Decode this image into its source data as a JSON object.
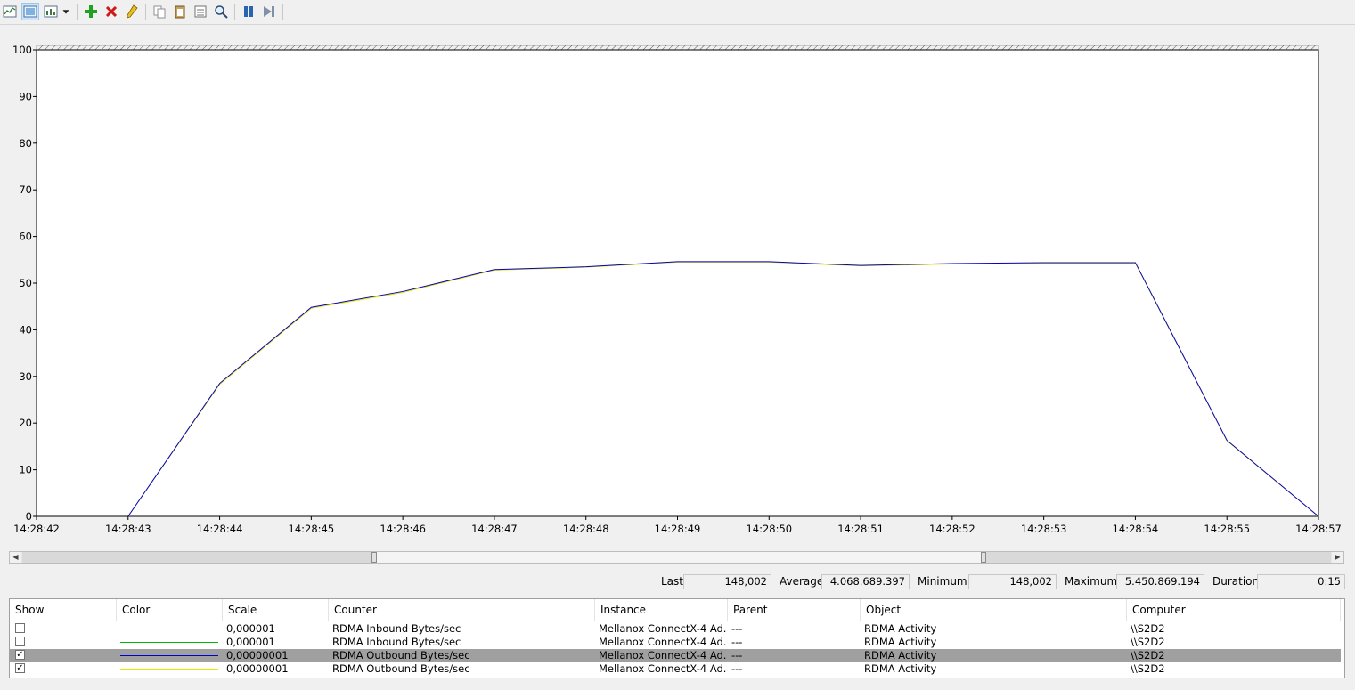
{
  "toolbar": {
    "buttons": [
      {
        "name": "view-current-activity-icon"
      },
      {
        "name": "change-graph-type-icon"
      },
      {
        "name": "graph-type-dropdown-icon"
      },
      {
        "name": "add-counter-icon"
      },
      {
        "name": "delete-counter-icon"
      },
      {
        "name": "highlight-icon"
      },
      {
        "name": "copy-properties-icon"
      },
      {
        "name": "paste-counter-list-icon"
      },
      {
        "name": "properties-icon"
      },
      {
        "name": "zoom-icon"
      },
      {
        "name": "freeze-display-icon"
      },
      {
        "name": "update-data-icon"
      }
    ]
  },
  "chart_data": {
    "type": "line",
    "ylim": [
      0,
      100
    ],
    "y_ticks": [
      "100",
      "90",
      "80",
      "70",
      "60",
      "50",
      "40",
      "30",
      "20",
      "10",
      "0"
    ],
    "x_ticks": [
      "14:28:42",
      "14:28:43",
      "14:28:44",
      "14:28:45",
      "14:28:46",
      "14:28:47",
      "14:28:48",
      "14:28:49",
      "14:28:50",
      "14:28:51",
      "14:28:52",
      "14:28:53",
      "14:28:54",
      "14:28:55",
      "14:28:57"
    ],
    "grid": false,
    "series": [
      {
        "name": "RDMA Outbound Bytes/sec",
        "color": "#0000cc",
        "x": [
          "14:28:43",
          "14:28:44",
          "14:28:45",
          "14:28:46",
          "14:28:47",
          "14:28:48",
          "14:28:49",
          "14:28:50",
          "14:28:51",
          "14:28:52",
          "14:28:53",
          "14:28:54",
          "14:28:55",
          "14:28:57"
        ],
        "y": [
          0,
          28.5,
          44.8,
          48.2,
          52.9,
          53.5,
          54.6,
          54.6,
          53.8,
          54.2,
          54.4,
          54.4,
          16.3,
          0
        ]
      },
      {
        "name": "RDMA Outbound Bytes/sec",
        "color": "#e8e800",
        "x": [
          "14:28:43",
          "14:28:44",
          "14:28:45",
          "14:28:46",
          "14:28:47",
          "14:28:48",
          "14:28:49",
          "14:28:50",
          "14:28:51",
          "14:28:52",
          "14:28:53",
          "14:28:54",
          "14:28:55",
          "14:28:57"
        ],
        "y": [
          0,
          28.3,
          44.6,
          48.0,
          52.8,
          53.4,
          54.5,
          54.5,
          53.7,
          54.1,
          54.3,
          54.3,
          16.2,
          0
        ]
      }
    ]
  },
  "stats": {
    "last_label": "Last",
    "last_value": "148,002",
    "average_label": "Average",
    "average_value": "4.068.689.397",
    "minimum_label": "Minimum",
    "minimum_value": "148,002",
    "maximum_label": "Maximum",
    "maximum_value": "5.450.869.194",
    "duration_label": "Duration",
    "duration_value": "0:15"
  },
  "table": {
    "columns": [
      "Show",
      "Color",
      "Scale",
      "Counter",
      "Instance",
      "Parent",
      "Object",
      "Computer"
    ],
    "rows": [
      {
        "show": false,
        "color": "#cc0000",
        "scale": "0,000001",
        "counter": "RDMA Inbound Bytes/sec",
        "instance": "Mellanox ConnectX-4 Ad...",
        "parent": "---",
        "object": "RDMA Activity",
        "computer": "\\\\S2D2",
        "selected": false
      },
      {
        "show": false,
        "color": "#00bb00",
        "scale": "0,000001",
        "counter": "RDMA Inbound Bytes/sec",
        "instance": "Mellanox ConnectX-4 Ad...",
        "parent": "---",
        "object": "RDMA Activity",
        "computer": "\\\\S2D2",
        "selected": false
      },
      {
        "show": true,
        "color": "#0000cc",
        "scale": "0,00000001",
        "counter": "RDMA Outbound Bytes/sec",
        "instance": "Mellanox ConnectX-4 Ad...",
        "parent": "---",
        "object": "RDMA Activity",
        "computer": "\\\\S2D2",
        "selected": true
      },
      {
        "show": true,
        "color": "#e8e800",
        "scale": "0,00000001",
        "counter": "RDMA Outbound Bytes/sec",
        "instance": "Mellanox ConnectX-4 Ad...",
        "parent": "---",
        "object": "RDMA Activity",
        "computer": "\\\\S2D2",
        "selected": false
      }
    ]
  }
}
